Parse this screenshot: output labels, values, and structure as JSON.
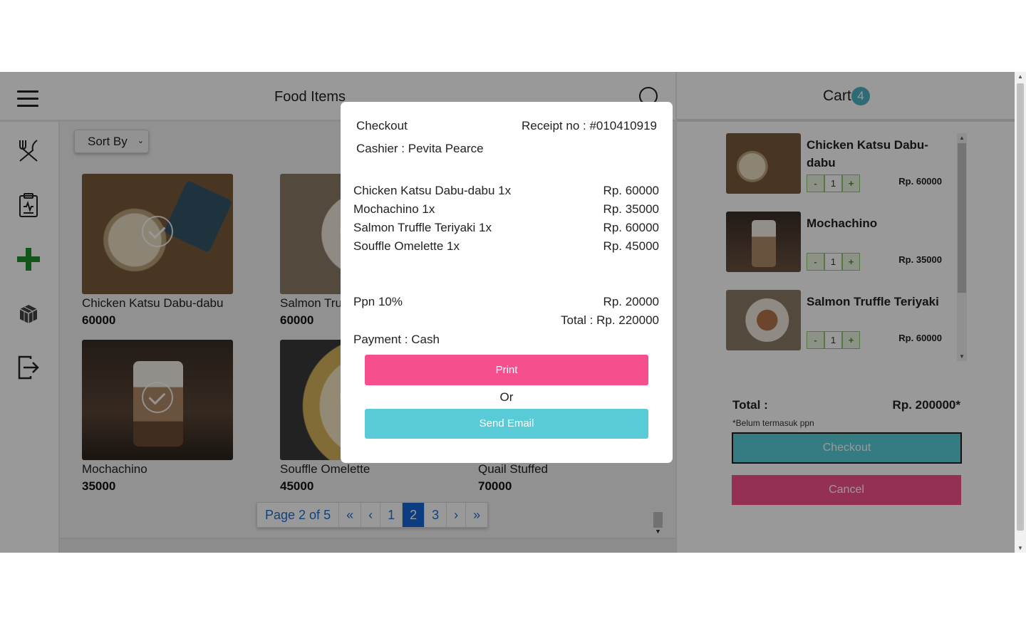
{
  "header": {
    "title": "Food Items",
    "search_icon": "search-icon",
    "menu_icon": "hamburger-icon"
  },
  "sidebar": {
    "items": [
      {
        "name": "utensils",
        "icon": "utensils-icon"
      },
      {
        "name": "report",
        "icon": "clipboard-icon"
      },
      {
        "name": "add",
        "icon": "plus-icon"
      },
      {
        "name": "inventory",
        "icon": "cube-icon"
      },
      {
        "name": "logout",
        "icon": "logout-icon"
      }
    ]
  },
  "content": {
    "sort_label": "Sort By",
    "foods": [
      {
        "name": "Chicken Katsu Dabu-dabu",
        "price": "60000",
        "selected": true
      },
      {
        "name": "Salmon Truffle Teriyaki",
        "price": "60000",
        "selected": true
      },
      {
        "name": "Mochachino",
        "price": "35000",
        "selected": true
      },
      {
        "name": "Souffle Omelette",
        "price": "45000",
        "selected": true
      },
      {
        "name": "Quail Stuffed",
        "price": "70000",
        "selected": false
      }
    ],
    "pager": {
      "label": "Page 2 of 5",
      "first": "«",
      "prev": "‹",
      "pages": [
        "1",
        "2",
        "3"
      ],
      "current": "2",
      "next": "›",
      "last": "»"
    }
  },
  "cart": {
    "title": "Cart",
    "count": "4",
    "items": [
      {
        "name": "Chicken Katsu Dabu-dabu",
        "qty": "1",
        "price": "Rp. 60000",
        "minus": "-",
        "plus": "+"
      },
      {
        "name": "Mochachino",
        "qty": "1",
        "price": "Rp. 35000",
        "minus": "-",
        "plus": "+"
      },
      {
        "name": "Salmon Truffle Teriyaki",
        "qty": "1",
        "price": "Rp. 60000",
        "minus": "-",
        "plus": "+"
      }
    ],
    "total_label": "Total :",
    "total_value": "Rp. 200000*",
    "ppn_note": "*Belum termasuk ppn",
    "checkout_label": "Checkout",
    "cancel_label": "Cancel"
  },
  "modal": {
    "title": "Checkout",
    "receipt": "Receipt no : #010410919",
    "cashier": "Cashier : Pevita Pearce",
    "lines": [
      {
        "item": "Chicken Katsu Dabu-dabu 1x",
        "price": "Rp. 60000"
      },
      {
        "item": "Mochachino 1x",
        "price": "Rp. 35000"
      },
      {
        "item": "Salmon Truffle Teriyaki 1x",
        "price": "Rp. 60000"
      },
      {
        "item": "Souffle Omelette 1x",
        "price": "Rp. 45000"
      }
    ],
    "ppn_label": "Ppn 10%",
    "ppn_value": "Rp. 20000",
    "total": "Total : Rp. 220000",
    "payment": "Payment : Cash",
    "print_label": "Print",
    "or_label": "Or",
    "email_label": "Send Email"
  },
  "colors": {
    "print": "#f5508d",
    "email": "#58cbd6",
    "badge": "#4fb3c4",
    "pager_active": "#1566d6",
    "plus_icon": "#1f8f2e"
  }
}
